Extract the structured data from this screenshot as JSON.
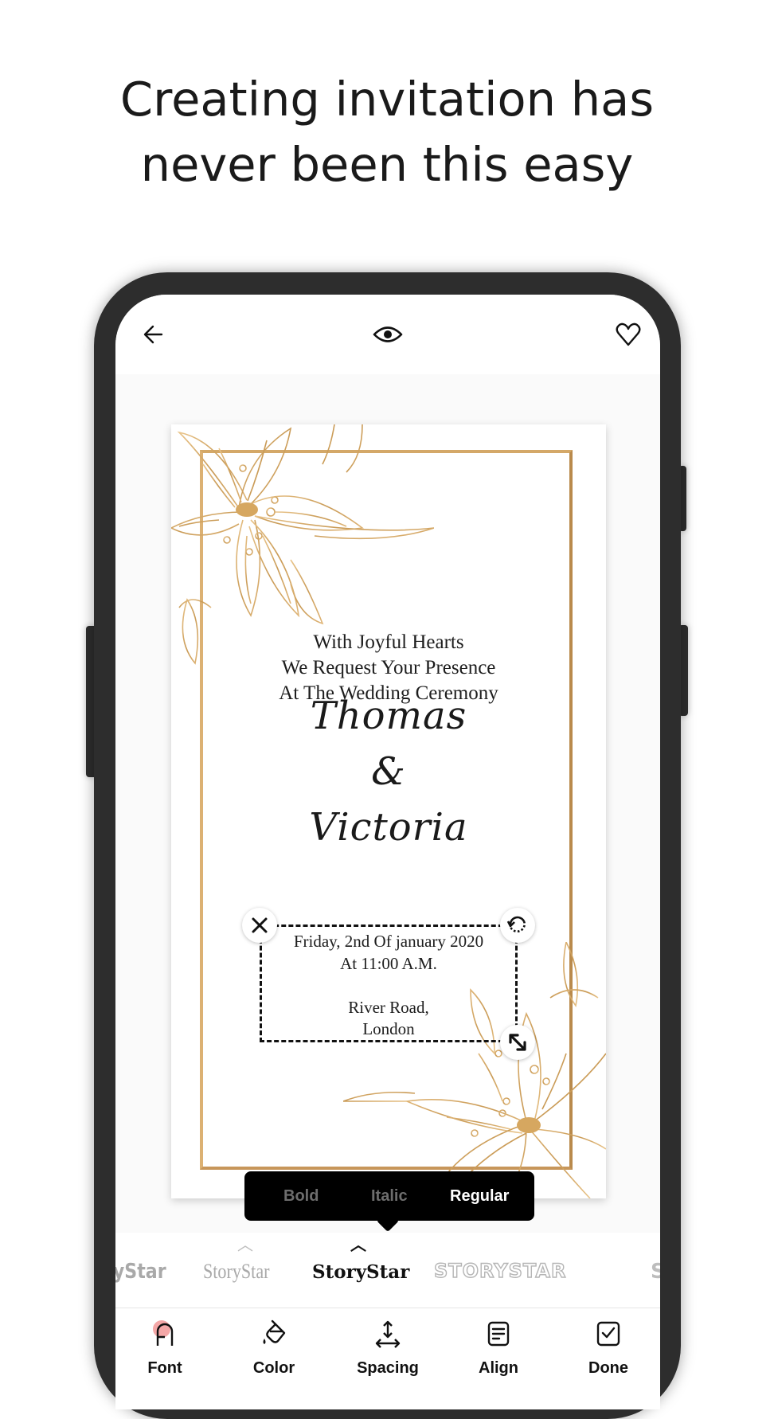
{
  "headline": {
    "line1": "Creating invitation has",
    "line2": "never been this easy"
  },
  "topbar": {
    "back_icon": "arrow-left",
    "preview_icon": "eye",
    "favorite_icon": "heart-outline"
  },
  "invitation": {
    "intro_lines": [
      "With Joyful Hearts",
      "We Request Your Presence",
      "At The Wedding Ceremony"
    ],
    "name1": "Thomas",
    "ampersand": "&",
    "name2": "Victoria",
    "details_lines": [
      "Friday, 2nd Of january 2020",
      "At 11:00 A.M.",
      "",
      "River Road,",
      "London"
    ],
    "accent_color": "#c99a55"
  },
  "selection_handles": {
    "delete_icon": "close",
    "rotate_icon": "rotate",
    "resize_icon": "resize-diagonal"
  },
  "style_popup": {
    "options": [
      "Bold",
      "Italic",
      "Regular"
    ],
    "selected": "Regular"
  },
  "font_strip": {
    "items": [
      "ryStar",
      "StoryStar",
      "StoryStar",
      "STORYSTAR",
      "S"
    ],
    "selected_index": 2
  },
  "bottom_toolbar": {
    "items": [
      {
        "label": "Font",
        "icon": "font"
      },
      {
        "label": "Color",
        "icon": "paint-bucket"
      },
      {
        "label": "Spacing",
        "icon": "spacing"
      },
      {
        "label": "Align",
        "icon": "align"
      },
      {
        "label": "Done",
        "icon": "check-square"
      }
    ],
    "active_badge_color": "#f4a7a7"
  }
}
